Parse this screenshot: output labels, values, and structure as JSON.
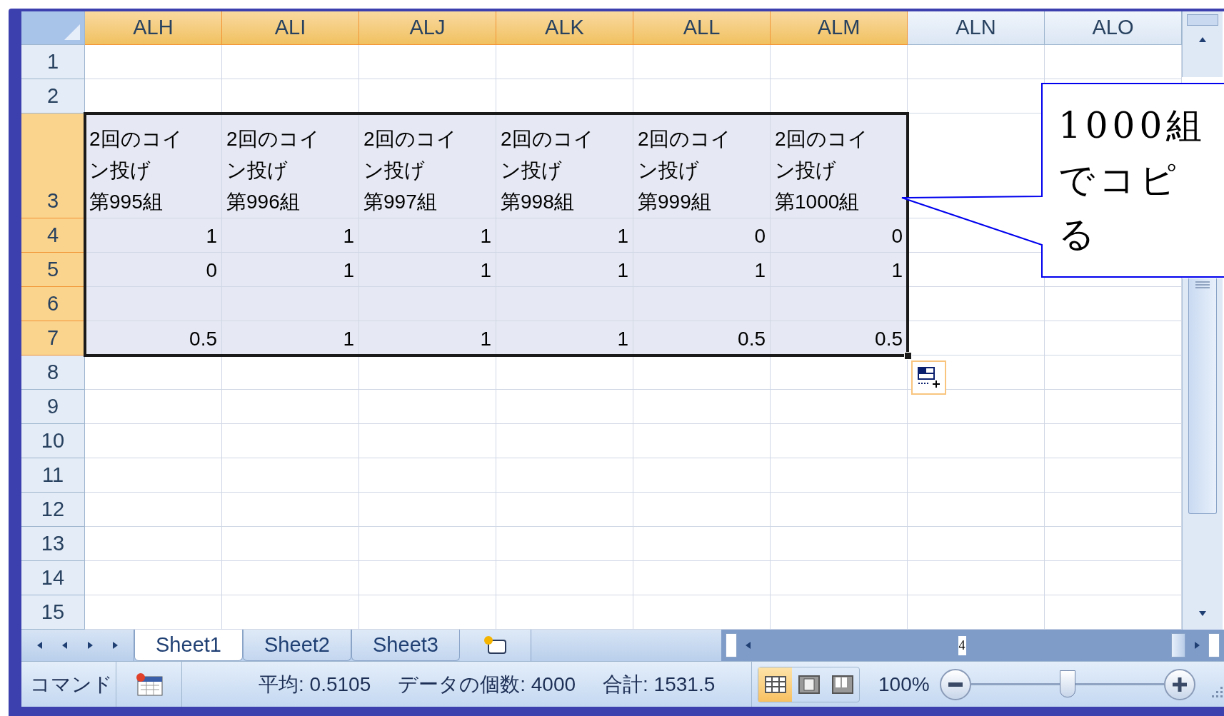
{
  "columns": [
    {
      "label": "ALH",
      "selected": true
    },
    {
      "label": "ALI",
      "selected": true
    },
    {
      "label": "ALJ",
      "selected": true
    },
    {
      "label": "ALK",
      "selected": true
    },
    {
      "label": "ALL",
      "selected": true
    },
    {
      "label": "ALM",
      "selected": true
    },
    {
      "label": "ALN",
      "selected": false
    },
    {
      "label": "ALO",
      "selected": false
    }
  ],
  "rows": [
    {
      "label": "1",
      "selected": false
    },
    {
      "label": "2",
      "selected": false
    },
    {
      "label": "3",
      "selected": true,
      "kind": "text",
      "cells": [
        {
          "lines": [
            "2回のコイ",
            "ン投げ",
            "第995組"
          ]
        },
        {
          "lines": [
            "2回のコイ",
            "ン投げ",
            "第996組"
          ]
        },
        {
          "lines": [
            "2回のコイ",
            "ン投げ",
            "第997組"
          ]
        },
        {
          "lines": [
            "2回のコイ",
            "ン投げ",
            "第998組"
          ]
        },
        {
          "lines": [
            "2回のコイ",
            "ン投げ",
            "第999組"
          ]
        },
        {
          "lines": [
            "2回のコイ",
            "ン投げ",
            "第1000組"
          ]
        }
      ]
    },
    {
      "label": "4",
      "selected": true,
      "kind": "number",
      "cells": [
        "1",
        "1",
        "1",
        "1",
        "0",
        "0"
      ]
    },
    {
      "label": "5",
      "selected": true,
      "kind": "number",
      "cells": [
        "0",
        "1",
        "1",
        "1",
        "1",
        "1"
      ]
    },
    {
      "label": "6",
      "selected": true
    },
    {
      "label": "7",
      "selected": true,
      "kind": "number",
      "cells": [
        "0.5",
        "1",
        "1",
        "1",
        "0.5",
        "0.5"
      ]
    },
    {
      "label": "8",
      "selected": false
    },
    {
      "label": "9",
      "selected": false
    },
    {
      "label": "10",
      "selected": false
    },
    {
      "label": "11",
      "selected": false
    },
    {
      "label": "12",
      "selected": false
    },
    {
      "label": "13",
      "selected": false
    },
    {
      "label": "14",
      "selected": false
    },
    {
      "label": "15",
      "selected": false
    }
  ],
  "callout": {
    "lines": [
      "1000組",
      "でコピ",
      "る"
    ]
  },
  "sheet_tabs": [
    {
      "label": "Sheet1",
      "selected": true
    },
    {
      "label": "Sheet2",
      "selected": false
    },
    {
      "label": "Sheet3",
      "selected": false
    }
  ],
  "horizontal_scroll": {
    "label": "4"
  },
  "status_bar": {
    "mode": "コマンド",
    "stats": [
      "平均: 0.5105",
      "データの個数: 4000",
      "合計: 1531.5"
    ],
    "views": [
      {
        "kind": "normal",
        "selected": true
      },
      {
        "kind": "page-layout",
        "selected": false
      },
      {
        "kind": "page-break",
        "selected": false
      }
    ],
    "zoom": "100%",
    "zoom_slider": {
      "level": 0.5
    }
  }
}
